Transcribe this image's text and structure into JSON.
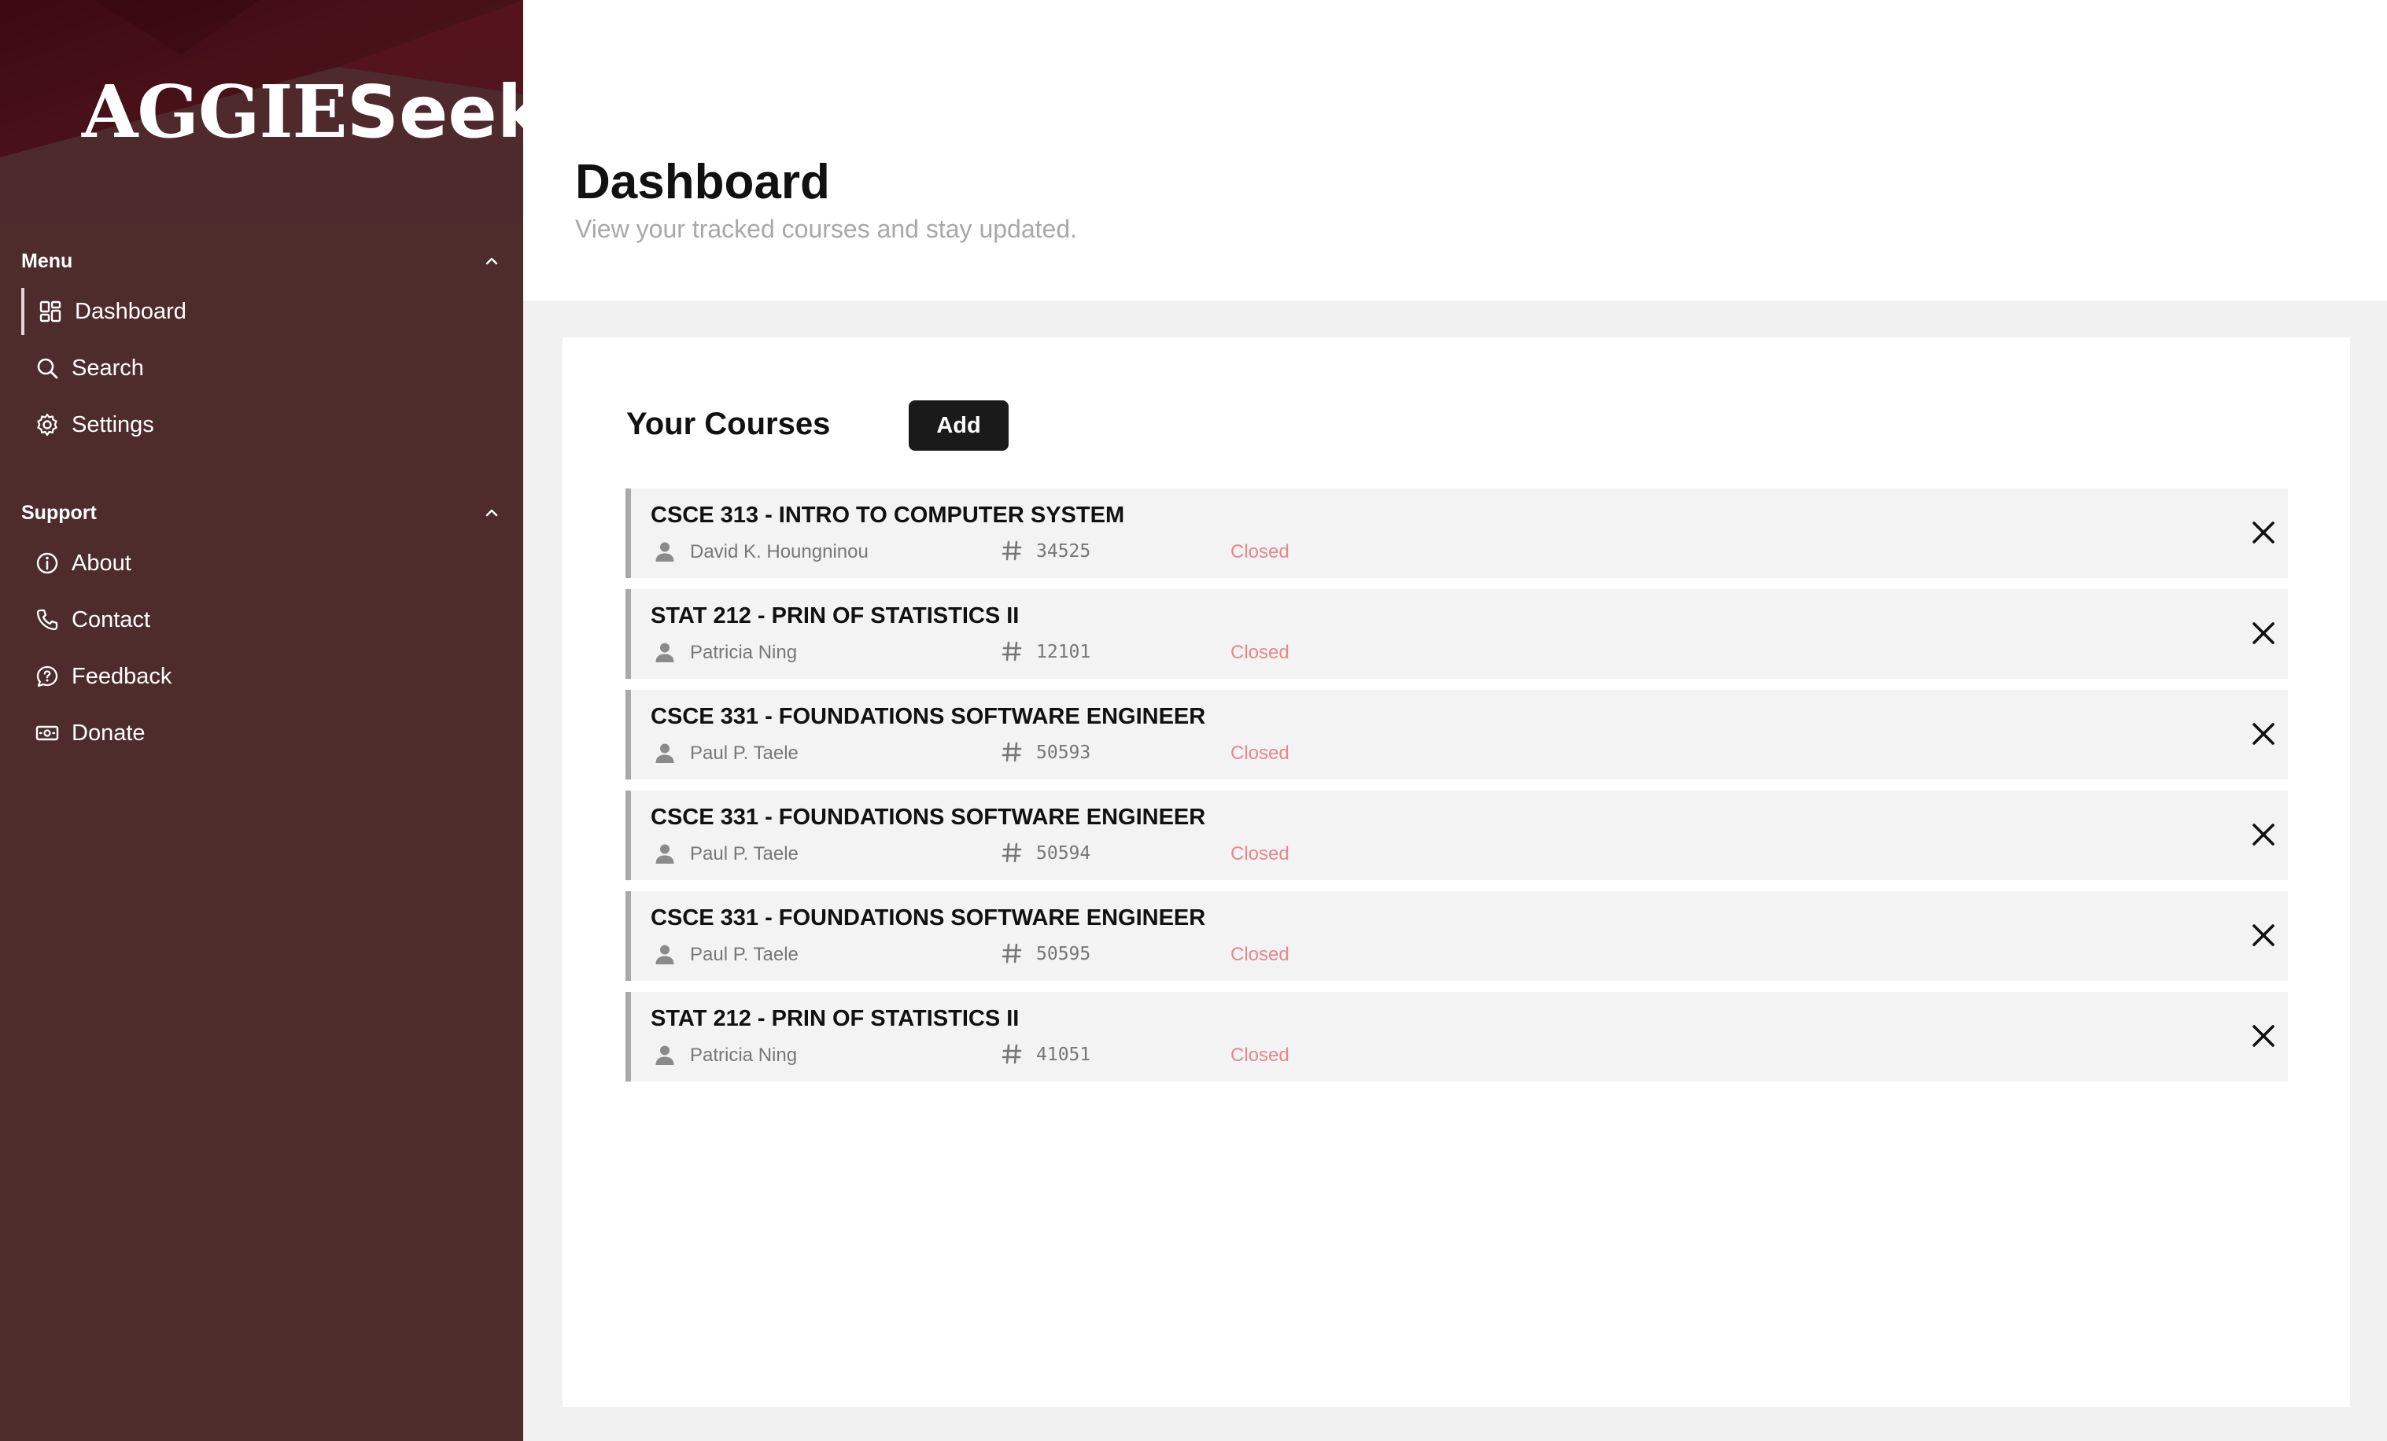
{
  "brand": {
    "prefix": "AGGIE",
    "suffix": "Seek"
  },
  "sidebar": {
    "sections": [
      {
        "title": "Menu",
        "items": [
          {
            "label": "Dashboard",
            "icon": "dashboard-icon",
            "active": true
          },
          {
            "label": "Search",
            "icon": "search-icon"
          },
          {
            "label": "Settings",
            "icon": "gear-icon"
          }
        ]
      },
      {
        "title": "Support",
        "items": [
          {
            "label": "About",
            "icon": "info-icon"
          },
          {
            "label": "Contact",
            "icon": "phone-icon"
          },
          {
            "label": "Feedback",
            "icon": "feedback-icon"
          },
          {
            "label": "Donate",
            "icon": "money-icon"
          }
        ]
      }
    ]
  },
  "header": {
    "title": "Dashboard",
    "subtitle": "View your tracked courses and stay updated."
  },
  "courses_card": {
    "title": "Your Courses",
    "add_label": "Add",
    "items": [
      {
        "name": "CSCE 313 - INTRO TO COMPUTER SYSTEM",
        "instructor": "David K. Houngninou",
        "crn": "34525",
        "status": "Closed"
      },
      {
        "name": "STAT 212 - PRIN OF STATISTICS II",
        "instructor": "Patricia Ning",
        "crn": "12101",
        "status": "Closed"
      },
      {
        "name": "CSCE 331 - FOUNDATIONS SOFTWARE ENGINEER",
        "instructor": "Paul P. Taele",
        "crn": "50593",
        "status": "Closed"
      },
      {
        "name": "CSCE 331 - FOUNDATIONS SOFTWARE ENGINEER",
        "instructor": "Paul P. Taele",
        "crn": "50594",
        "status": "Closed"
      },
      {
        "name": "CSCE 331 - FOUNDATIONS SOFTWARE ENGINEER",
        "instructor": "Paul P. Taele",
        "crn": "50595",
        "status": "Closed"
      },
      {
        "name": "STAT 212 - PRIN OF STATISTICS II",
        "instructor": "Patricia Ning",
        "crn": "41051",
        "status": "Closed"
      }
    ]
  },
  "colors": {
    "sidebar_bg": "#4e2c2c",
    "status_closed": "#e8868e",
    "course_accent_border": "#a9a9ad"
  }
}
